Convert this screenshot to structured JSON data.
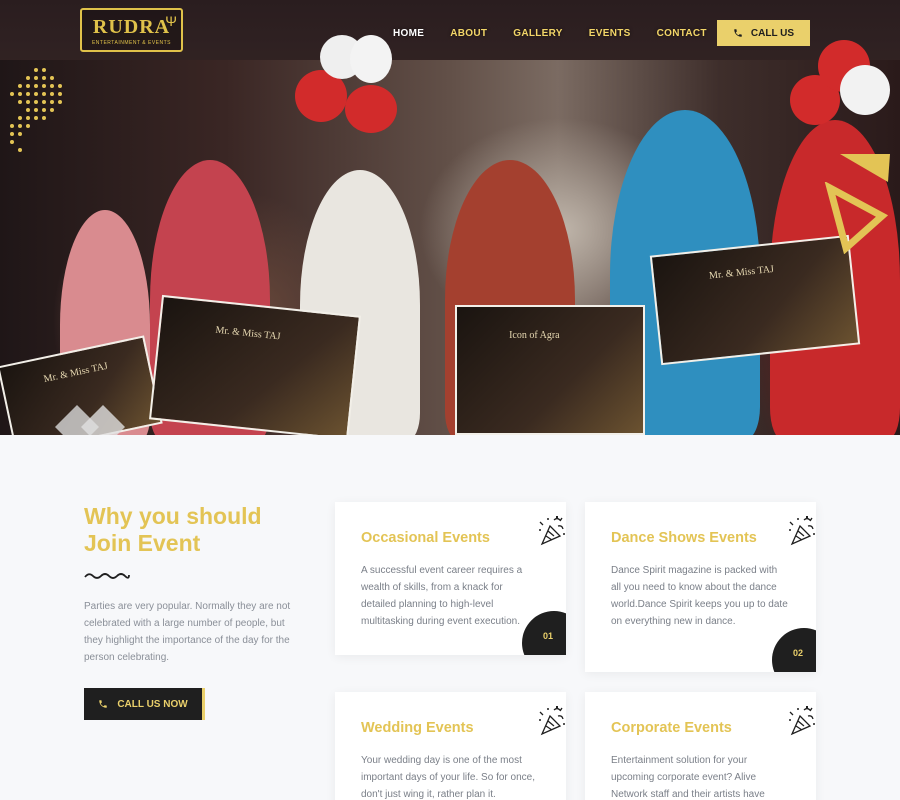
{
  "brand": {
    "name": "RUDRA",
    "tagline": "ENTERTAINMENT & EVENTS"
  },
  "nav": {
    "items": [
      {
        "label": "HOME",
        "active": true
      },
      {
        "label": "ABOUT",
        "active": false
      },
      {
        "label": "GALLERY",
        "active": false
      },
      {
        "label": "EVENTS",
        "active": false
      },
      {
        "label": "CONTACT",
        "active": false
      }
    ],
    "call_label": "CALL US"
  },
  "hero": {
    "poster_title_lines": [
      "Mr. & Miss TAJ",
      "Icon of Agra"
    ]
  },
  "why": {
    "title_line1": "Why you should",
    "title_line2": "Join Event",
    "description": "Parties are very popular. Normally they are not celebrated with a large number of people, but they highlight the importance of the day for the person celebrating.",
    "button_label": "CALL US NOW"
  },
  "cards": [
    {
      "title": "Occasional Events",
      "text": "A successful event career requires a wealth of skills, from a knack for detailed planning to high-level multitasking during event execution.",
      "number": "01"
    },
    {
      "title": "Dance Shows Events",
      "text": "Dance Spirit magazine is packed with all you need to know about the dance world.Dance Spirit keeps you up to date on everything new in dance.",
      "number": "02"
    },
    {
      "title": "Wedding Events",
      "text": "Your wedding day is one of the most important days of your life. So for once, don't just wing it, rather plan it.",
      "number": ""
    },
    {
      "title": "Corporate Events",
      "text": "Entertainment solution for your upcoming corporate event? Alive Network staff and their artists have",
      "number": ""
    }
  ],
  "colors": {
    "accent": "#e3c455",
    "dark": "#1f1f1f",
    "button": "#ead06b"
  }
}
